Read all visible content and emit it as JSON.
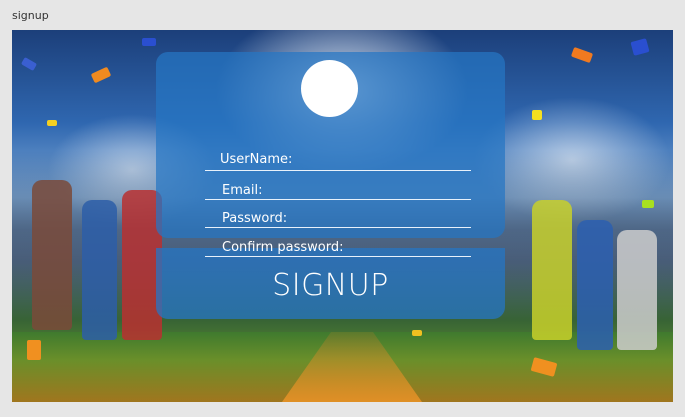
{
  "window": {
    "title": "signup"
  },
  "form": {
    "fields": [
      {
        "label": "UserName:"
      },
      {
        "label": "Email:"
      },
      {
        "label": "Password:"
      },
      {
        "label": "Confirm password:"
      }
    ],
    "submit_label": "SIGNUP"
  },
  "colors": {
    "panel": "#2676c4",
    "text": "#ffffff",
    "avatar": "#ffffff"
  },
  "background": {
    "image": "sports-athletes-stadium"
  }
}
